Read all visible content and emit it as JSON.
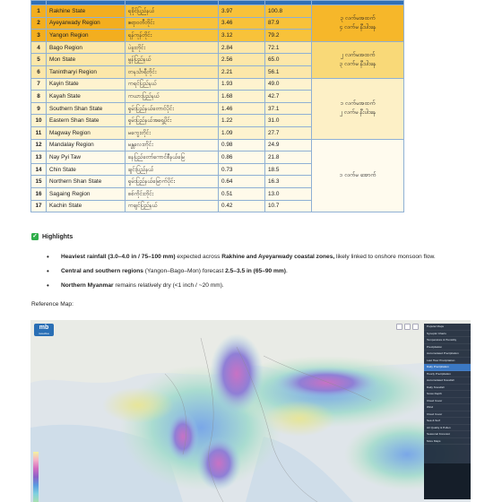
{
  "table": {
    "header": [
      "",
      "",
      "",
      "",
      "",
      ""
    ],
    "rows": [
      {
        "no": "1",
        "region": "Rakhine State",
        "mm": "ရခိုင်ပြည်နယ်",
        "inches": "3.97",
        "millimeters": "100.8"
      },
      {
        "no": "2",
        "region": "Ayeyarwady Region",
        "mm": "ဧရာဝတီတိုင်း",
        "inches": "3.46",
        "millimeters": "87.9"
      },
      {
        "no": "3",
        "region": "Yangon Region",
        "mm": "ရန်ကုန်တိုင်း",
        "inches": "3.12",
        "millimeters": "79.2"
      },
      {
        "no": "4",
        "region": "Bago Region",
        "mm": "ပဲခူးတိုင်း",
        "inches": "2.84",
        "millimeters": "72.1"
      },
      {
        "no": "5",
        "region": "Mon State",
        "mm": "မွန်ပြည်နယ်",
        "inches": "2.56",
        "millimeters": "65.0"
      },
      {
        "no": "6",
        "region": "Tanintharyi Region",
        "mm": "တနင်္သာရီတိုင်း",
        "inches": "2.21",
        "millimeters": "56.1"
      },
      {
        "no": "7",
        "region": "Kayin State",
        "mm": "ကရင်ပြည်နယ်",
        "inches": "1.93",
        "millimeters": "49.0"
      },
      {
        "no": "8",
        "region": "Kayah State",
        "mm": "ကယားပြည်နယ်",
        "inches": "1.68",
        "millimeters": "42.7"
      },
      {
        "no": "9",
        "region": "Southern Shan State",
        "mm": "ရှမ်းပြည်နယ်တောင်ပိုင်း",
        "inches": "1.46",
        "millimeters": "37.1"
      },
      {
        "no": "10",
        "region": "Eastern Shan State",
        "mm": "ရှမ်းပြည်နယ်အရှေ့ပိုင်း",
        "inches": "1.22",
        "millimeters": "31.0"
      },
      {
        "no": "11",
        "region": "Magway Region",
        "mm": "မကွေးတိုင်း",
        "inches": "1.09",
        "millimeters": "27.7"
      },
      {
        "no": "12",
        "region": "Mandalay Region",
        "mm": "မန္တလေးတိုင်း",
        "inches": "0.98",
        "millimeters": "24.9"
      },
      {
        "no": "13",
        "region": "Nay Pyi Taw",
        "mm": "နေပြည်တော်ကောင်စီနယ်မြေ",
        "inches": "0.86",
        "millimeters": "21.8"
      },
      {
        "no": "14",
        "region": "Chin State",
        "mm": "ချင်းပြည်နယ်",
        "inches": "0.73",
        "millimeters": "18.5"
      },
      {
        "no": "15",
        "region": "Northern Shan State",
        "mm": "ရှမ်းပြည်နယ်မြောက်ပိုင်း",
        "inches": "0.64",
        "millimeters": "16.3"
      },
      {
        "no": "16",
        "region": "Sagaing Region",
        "mm": "စစ်ကိုင်းတိုင်း",
        "inches": "0.51",
        "millimeters": "13.0"
      },
      {
        "no": "17",
        "region": "Kachin State",
        "mm": "ကချင်ပြည်နယ်",
        "inches": "0.42",
        "millimeters": "10.7"
      }
    ],
    "categories": [
      "၃ လက်မအထက်\n၄ လက်မ နီးပါးနေ",
      "၂ လက်မအထက်\n၃ လက်မ နီးပါးနေ",
      "၁ လက်မအထက်\n၂ လက်မ နီးပါးနေ",
      "၁ လက်မ အောက်"
    ]
  },
  "highlights": {
    "title": "Highlights",
    "items": [
      {
        "b1": "Heaviest rainfall (3.0–4.0 in / 75–100 mm)",
        "t1": " expected across ",
        "b2": "Rakhine and Ayeyarwady coastal zones,",
        "t2": " likely linked to onshore monsoon flow."
      },
      {
        "b1": "Central and southern regions",
        "t1": " (Yangon–Bago–Mon) forecast ",
        "b2": "2.5–3.5 in (65–90 mm)",
        "t2": "."
      },
      {
        "b1": "Northern Myanmar",
        "t1": " remains relatively dry (<1 inch / ~20 mm).",
        "b2": "",
        "t2": ""
      }
    ]
  },
  "reference_label": "Reference Map:",
  "map": {
    "logo_text": "mb",
    "logo_sub": "meteoblue",
    "menu_items": [
      "Popular Maps",
      "Synoptic Charts",
      "Temperature & Humidity",
      "Precipitation",
      "Accumulated Precipitation",
      "Last Hour Precipitation",
      "Daily Precipitation",
      "Hourly Precipitation",
      "Accumulated Snowfall",
      "Daily Snowfall",
      "Snow Depth",
      "Cloud Cover",
      "Wind",
      "Cloud Cover",
      "Sea & Surf",
      "Air Quality & Pollen",
      "Seasonal Forecast",
      "More Maps"
    ],
    "active_item": "Daily Precipitation",
    "accent_color": "#3b78c4"
  }
}
